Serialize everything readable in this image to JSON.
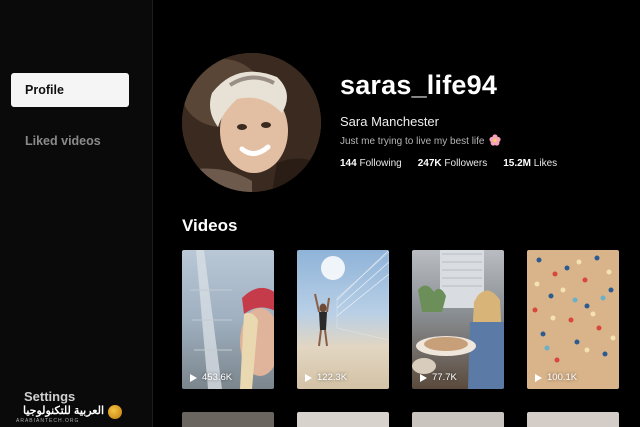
{
  "sidebar": {
    "items": [
      {
        "label": "Profile",
        "active": true
      },
      {
        "label": "Liked videos",
        "active": false
      }
    ],
    "settings_label": "Settings",
    "watermark": {
      "text": "العربية للتكنولوجيا",
      "sub": "ARABIANTECH.ORG"
    }
  },
  "profile": {
    "username": "saras_life94",
    "full_name": "Sara Manchester",
    "bio": "Just me trying to live my best life",
    "bio_emoji": "flower-icon",
    "stats": {
      "following_count": "144",
      "following_label": "Following",
      "followers_count": "247K",
      "followers_label": "Followers",
      "likes_count": "15.2M",
      "likes_label": "Likes"
    }
  },
  "videos": {
    "title": "Videos",
    "items": [
      {
        "views": "453.6K"
      },
      {
        "views": "122.3K"
      },
      {
        "views": "77.7K"
      },
      {
        "views": "100.1K"
      }
    ]
  },
  "colors": {
    "background": "#000000",
    "sidebar_active_bg": "#f5f5f5",
    "muted_text": "#8a8a8a"
  }
}
